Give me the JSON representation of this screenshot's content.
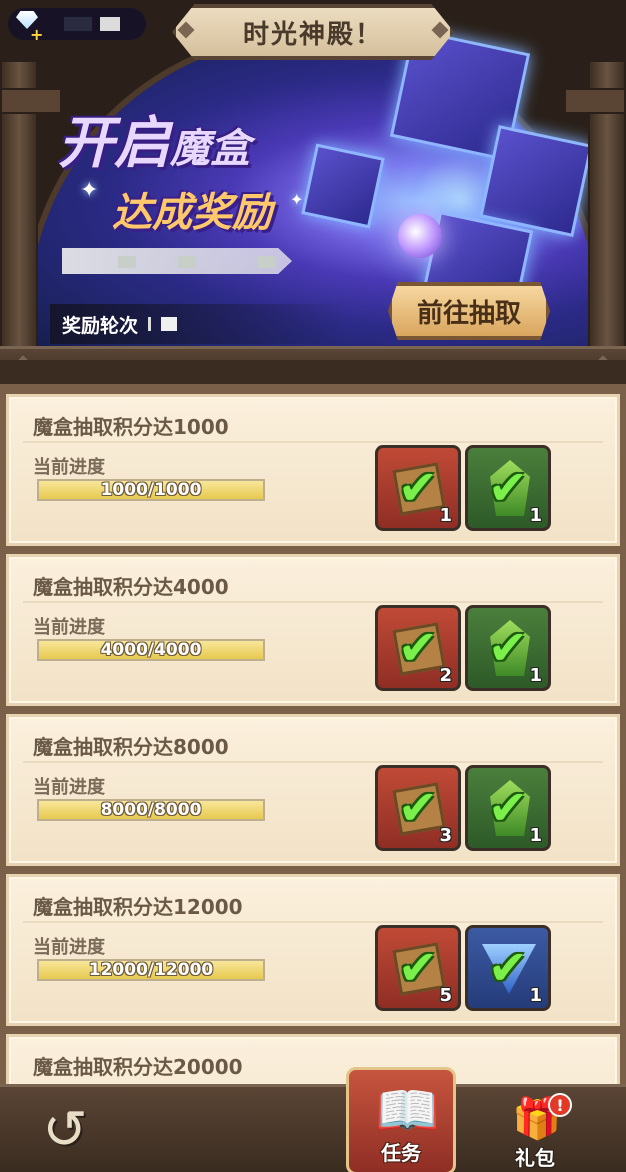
{
  "header": {
    "title": "时光神殿！",
    "currency_icon": "diamond-plus-icon"
  },
  "banner": {
    "headline_main": "开启",
    "headline_main_small": "魔盒",
    "headline_sub": "达成奖励",
    "round_label": "奖励轮次",
    "go_button": "前往抽取",
    "colors": {
      "accent": "#ffc96b",
      "button": "#d9a65e"
    }
  },
  "tasks": [
    {
      "title": "魔盒抽取积分达1000",
      "progress_label": "当前进度",
      "progress_text": "1000/1000",
      "progress": 1.0,
      "rewards": [
        {
          "icon": "treasure-box-icon",
          "type": "red",
          "count": "1",
          "claimed": true
        },
        {
          "icon": "green-gem-icon",
          "type": "green",
          "count": "1",
          "claimed": true
        }
      ]
    },
    {
      "title": "魔盒抽取积分达4000",
      "progress_label": "当前进度",
      "progress_text": "4000/4000",
      "progress": 1.0,
      "rewards": [
        {
          "icon": "treasure-box-icon",
          "type": "red",
          "count": "2",
          "claimed": true
        },
        {
          "icon": "green-gem-icon",
          "type": "green",
          "count": "1",
          "claimed": true
        }
      ]
    },
    {
      "title": "魔盒抽取积分达8000",
      "progress_label": "当前进度",
      "progress_text": "8000/8000",
      "progress": 1.0,
      "rewards": [
        {
          "icon": "treasure-box-icon",
          "type": "red",
          "count": "3",
          "claimed": true
        },
        {
          "icon": "green-gem-icon",
          "type": "green",
          "count": "1",
          "claimed": true
        }
      ]
    },
    {
      "title": "魔盒抽取积分达12000",
      "progress_label": "当前进度",
      "progress_text": "12000/12000",
      "progress": 1.0,
      "rewards": [
        {
          "icon": "treasure-box-icon",
          "type": "red",
          "count": "5",
          "claimed": true
        },
        {
          "icon": "blue-gem-icon",
          "type": "blue",
          "count": "1",
          "claimed": true
        }
      ]
    },
    {
      "title": "魔盒抽取积分达20000"
    }
  ],
  "nav": {
    "back_icon": "back-arrow-icon",
    "task_label": "任务",
    "task_icon": "book-icon",
    "gift_label": "礼包",
    "gift_icon": "gift-icon",
    "gift_badge": "!"
  }
}
